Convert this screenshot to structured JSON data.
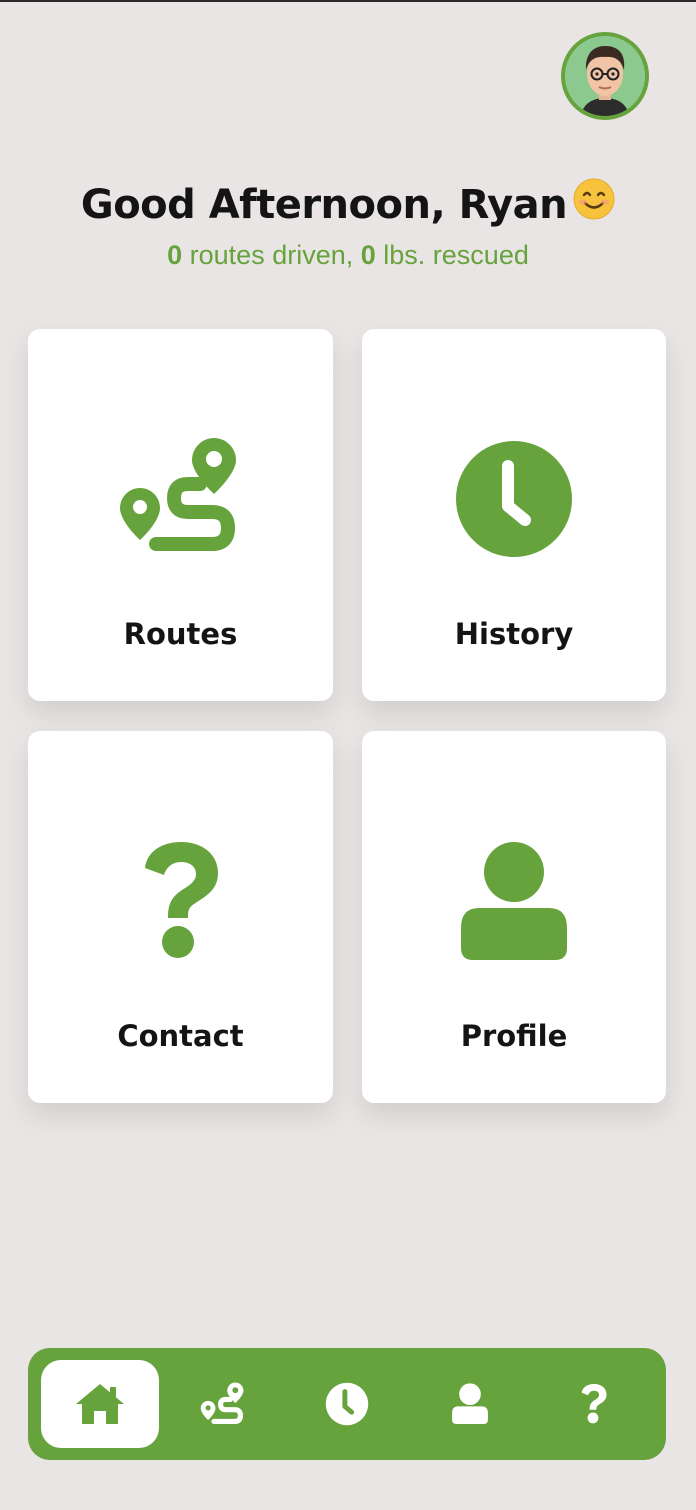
{
  "header": {
    "greeting": "Good Afternoon, Ryan",
    "greeting_emoji": "smiling-face-icon",
    "stats": {
      "routes_count": "0",
      "routes_text": " routes driven, ",
      "lbs_count": "0",
      "lbs_text": " lbs. rescued"
    },
    "avatar_icon": "user-avatar"
  },
  "cards": [
    {
      "label": "Routes",
      "icon": "route-icon"
    },
    {
      "label": "History",
      "icon": "clock-icon"
    },
    {
      "label": "Contact",
      "icon": "question-icon"
    },
    {
      "label": "Profile",
      "icon": "user-icon"
    }
  ],
  "nav": {
    "items": [
      {
        "name": "home",
        "icon": "home-icon",
        "active": true
      },
      {
        "name": "routes",
        "icon": "route-icon",
        "active": false
      },
      {
        "name": "history",
        "icon": "clock-icon",
        "active": false
      },
      {
        "name": "profile",
        "icon": "user-icon",
        "active": false
      },
      {
        "name": "contact",
        "icon": "question-icon",
        "active": false
      }
    ]
  },
  "colors": {
    "accent": "#67a33c",
    "background": "#e8e5e4",
    "card": "#ffffff",
    "text": "#141414"
  }
}
